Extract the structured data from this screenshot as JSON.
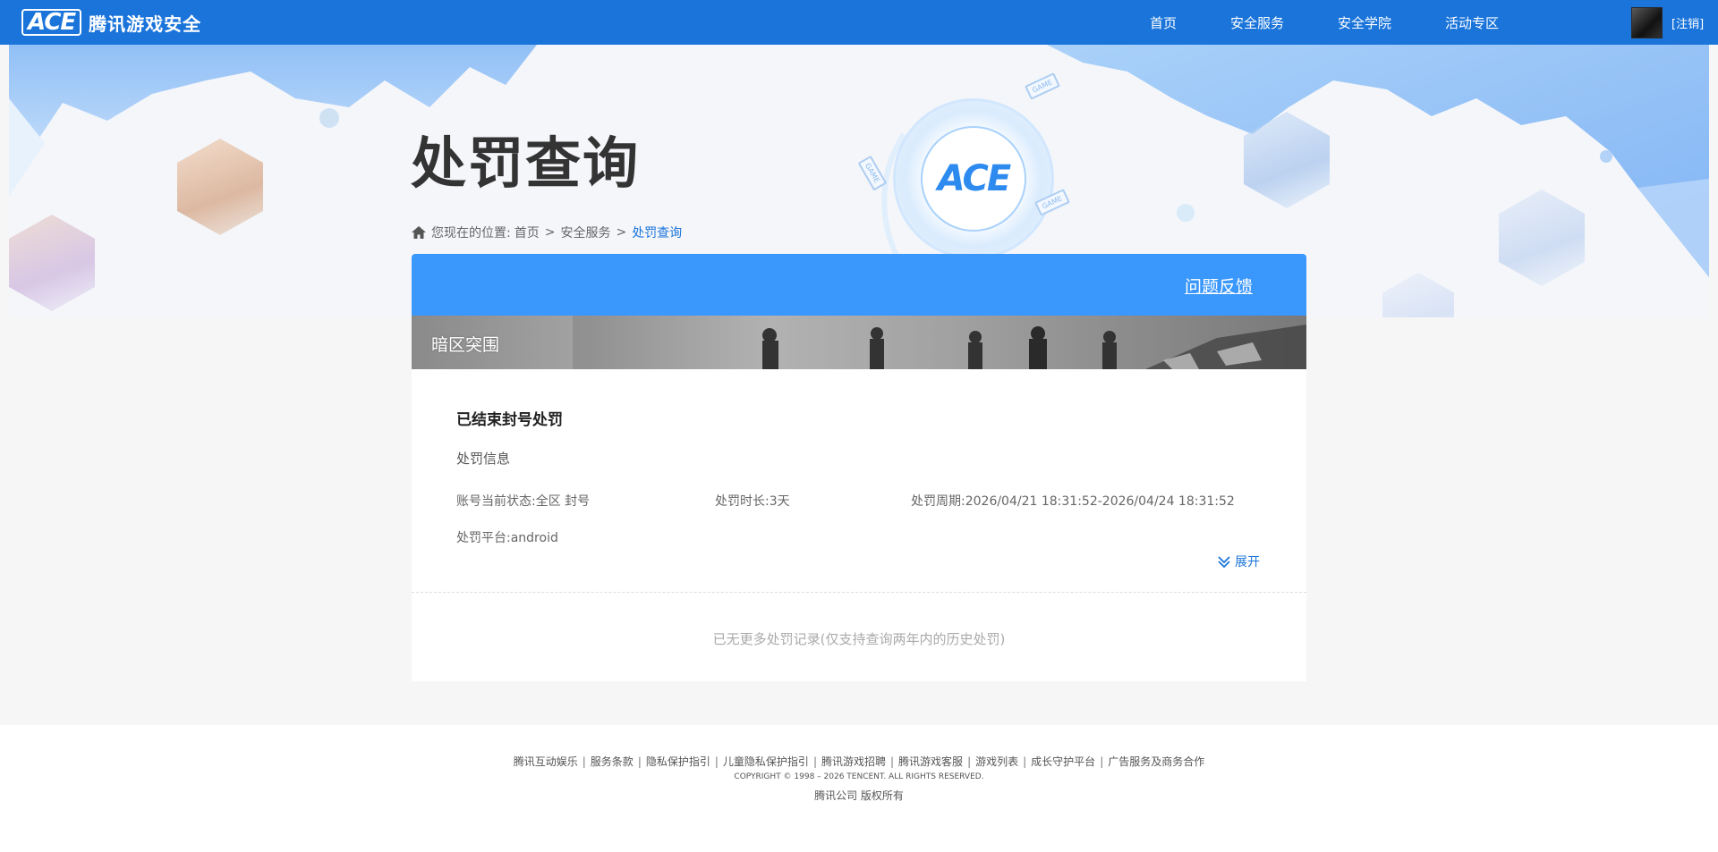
{
  "header": {
    "logo_mark": "ACE",
    "logo_text": "腾讯游戏安全",
    "nav": [
      {
        "label": "首页"
      },
      {
        "label": "安全服务"
      },
      {
        "label": "安全学院"
      },
      {
        "label": "活动专区"
      }
    ],
    "logout_label": "[注销]"
  },
  "hero": {
    "title": "处罚查询",
    "ace_label": "ACE",
    "game_tags": [
      "GAME",
      "GAME",
      "GAME"
    ]
  },
  "breadcrumb": {
    "prefix": "您现在的位置:",
    "items": [
      "首页",
      "安全服务"
    ],
    "current": "处罚查询",
    "separator": ">"
  },
  "card": {
    "feedback_label": "问题反馈",
    "game_name": "暗区突围",
    "record": {
      "title": "已结束封号处罚",
      "section_label": "处罚信息",
      "status": "账号当前状态:全区 封号",
      "duration": "处罚时长:3天",
      "period": "处罚周期:2026/04/21 18:31:52-2026/04/24 18:31:52",
      "platform": "处罚平台:android",
      "expand_label": "展开"
    },
    "no_more": "已无更多处罚记录(仅支持查询两年内的历史处罚)"
  },
  "footer": {
    "links": [
      "腾讯互动娱乐",
      "服务条款",
      "隐私保护指引",
      "儿童隐私保护指引",
      "腾讯游戏招聘",
      "腾讯游戏客服",
      "游戏列表",
      "成长守护平台",
      "广告服务及商务合作"
    ],
    "copyright": "COPYRIGHT © 1998 – 2026 TENCENT. ALL RIGHTS RESERVED.",
    "company": "腾讯公司 版权所有"
  },
  "colors": {
    "topbar": "#1a74da",
    "card_header": "#3a97fc",
    "accent": "#1a74da"
  }
}
